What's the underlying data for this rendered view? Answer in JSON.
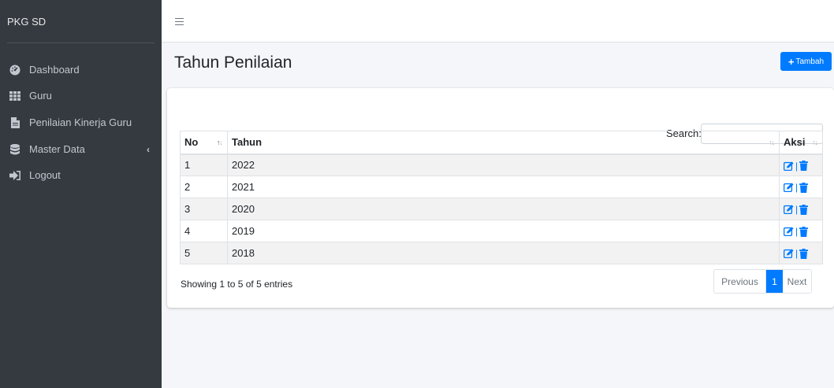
{
  "sidebar": {
    "brand": "PKG SD",
    "items": [
      {
        "label": "Dashboard",
        "icon": "tachometer-icon"
      },
      {
        "label": "Guru",
        "icon": "grid-icon"
      },
      {
        "label": "Penilaian Kinerja Guru",
        "icon": "file-icon"
      },
      {
        "label": "Master Data",
        "icon": "database-icon"
      },
      {
        "label": "Logout",
        "icon": "sign-out-icon"
      }
    ]
  },
  "header": {
    "menu_icon": "hamburger-icon"
  },
  "main": {
    "title": "Tahun Penilaian",
    "add_button": "Tambah",
    "search_label": "Search:",
    "search_value": "",
    "table": {
      "columns": [
        "No",
        "Tahun",
        "Aksi"
      ],
      "rows": [
        {
          "no": "1",
          "tahun": "2022"
        },
        {
          "no": "2",
          "tahun": "2021"
        },
        {
          "no": "3",
          "tahun": "2020"
        },
        {
          "no": "4",
          "tahun": "2019"
        },
        {
          "no": "5",
          "tahun": "2018"
        }
      ],
      "action_separator": "|",
      "action_icons": [
        "edit-icon",
        "trash-icon"
      ]
    },
    "info": "Showing 1 to 5 of 5 entries",
    "pagination": {
      "previous": "Previous",
      "current": "1",
      "next": "Next"
    }
  },
  "colors": {
    "sidebar_bg": "#343a40",
    "primary": "#007bff",
    "content_bg": "#f4f6f9"
  }
}
